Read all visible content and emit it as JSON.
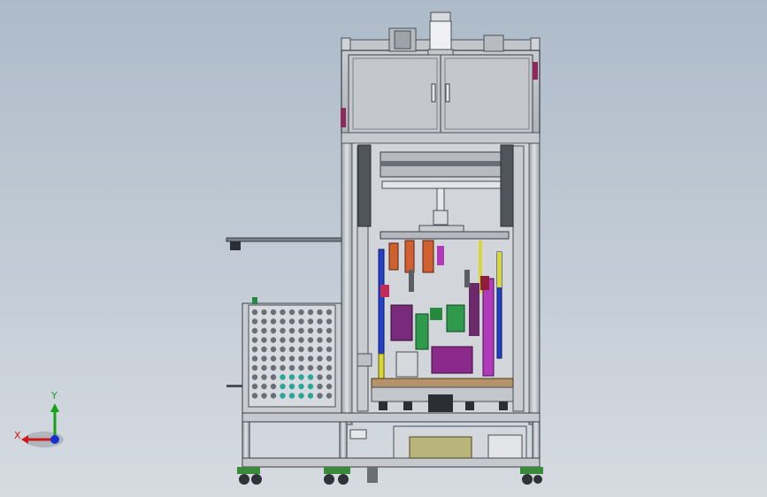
{
  "viewport": {
    "background_top": "#adbbc9",
    "background_bottom": "#d6dbe1"
  },
  "triad": {
    "x_label": "X",
    "y_label": "Y",
    "x_color": "#d01818",
    "y_color": "#18a018",
    "z_color": "#1830d0"
  },
  "model": {
    "frame_color": "#c8ccd2",
    "frame_outline": "#4a4f56",
    "cabinet_color": "#bfc3c8",
    "handle_color": "#8c2a5a",
    "cylinder_color": "#e6e9ec",
    "gear_color": "#27893d",
    "blue_rod_color": "#2440c8",
    "yellow_rod_color": "#d8d838",
    "magenta_part_color": "#b03ab8",
    "orange_part_color": "#d06030",
    "perforated_panel_color": "#d7dbe0",
    "panel_hole_color": "#6a6f78",
    "cyan_hole_color": "#2aa59a",
    "drawer_color": "#b9b57a"
  }
}
